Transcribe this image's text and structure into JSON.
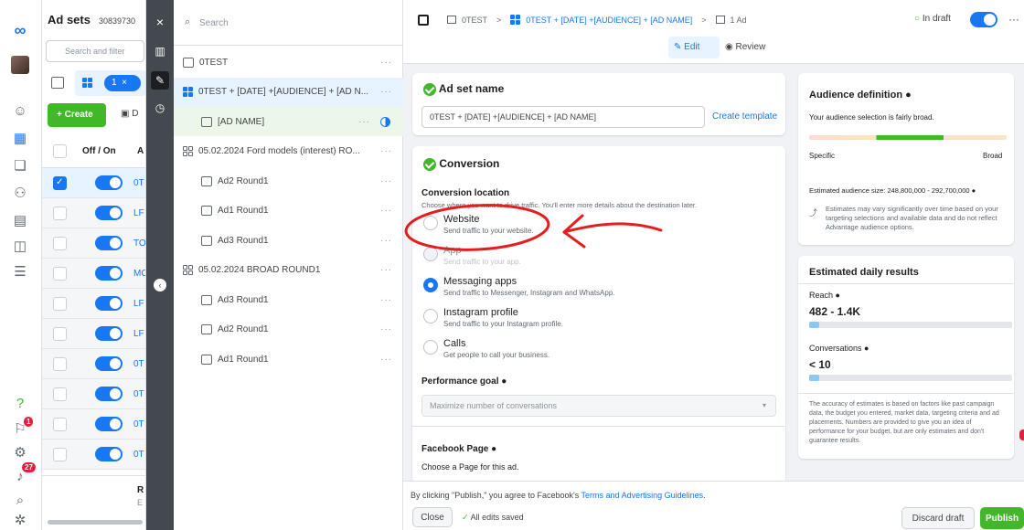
{
  "app": {
    "title": "Ad sets",
    "account_id": "30839730"
  },
  "rail": {
    "badge_notifications": "1",
    "badge_alerts": "27"
  },
  "table": {
    "search_placeholder": "Search and filter",
    "selected_count": "1",
    "create_label": "+ Create",
    "dup_label": "D",
    "col_offon": "Off / On",
    "col_name": "A",
    "rows": [
      {
        "name": "0T",
        "checked": true
      },
      {
        "name": "LF",
        "checked": false
      },
      {
        "name": "TO",
        "checked": false
      },
      {
        "name": "MC",
        "checked": false
      },
      {
        "name": "LF",
        "checked": false
      },
      {
        "name": "LF",
        "checked": false
      },
      {
        "name": "0T",
        "checked": false
      },
      {
        "name": "0T",
        "checked": false
      },
      {
        "name": "0T",
        "checked": false
      },
      {
        "name": "0T",
        "checked": false
      }
    ],
    "footer_r": "R",
    "footer_e": "E"
  },
  "tree": {
    "search_placeholder": "Search",
    "items": [
      {
        "label": "0TEST",
        "kind": "campaign",
        "indent": 0,
        "selected": false
      },
      {
        "label": "0TEST + [DATE] +[AUDIENCE] + [AD N...",
        "kind": "adset-blue",
        "indent": 0,
        "selected": true
      },
      {
        "label": "[AD NAME]",
        "kind": "ad",
        "indent": 1,
        "selected": true
      },
      {
        "label": "05.02.2024 Ford models (interest) RO...",
        "kind": "adset-gray",
        "indent": 0,
        "selected": false
      },
      {
        "label": "Ad2 Round1",
        "kind": "ad",
        "indent": 1,
        "selected": false
      },
      {
        "label": "Ad1 Round1",
        "kind": "ad",
        "indent": 1,
        "selected": false
      },
      {
        "label": "Ad3 Round1",
        "kind": "ad",
        "indent": 1,
        "selected": false
      },
      {
        "label": "05.02.2024 BROAD ROUND1",
        "kind": "adset-gray",
        "indent": 0,
        "selected": false
      },
      {
        "label": "Ad3 Round1",
        "kind": "ad",
        "indent": 1,
        "selected": false
      },
      {
        "label": "Ad2 Round1",
        "kind": "ad",
        "indent": 1,
        "selected": false
      },
      {
        "label": "Ad1 Round1",
        "kind": "ad",
        "indent": 1,
        "selected": false
      }
    ]
  },
  "breadcrumb": {
    "campaign": "0TEST",
    "adset": "0TEST + [DATE] +[AUDIENCE] + [AD NAME]",
    "ad": "1 Ad",
    "status": "In draft",
    "sep": ">"
  },
  "modes": {
    "edit": "Edit",
    "review": "Review"
  },
  "adset_name": {
    "heading": "Ad set name",
    "value": "0TEST + [DATE] +[AUDIENCE] + [AD NAME]",
    "template_link": "Create template"
  },
  "conversion": {
    "heading": "Conversion",
    "location_label": "Conversion location",
    "location_desc": "Choose where you want to drive traffic. You'll enter more details about the destination later.",
    "options": [
      {
        "title": "Website",
        "sub": "Send traffic to your website.",
        "selected": false
      },
      {
        "title": "App",
        "sub": "Send traffic to your app.",
        "selected": false
      },
      {
        "title": "Messaging apps",
        "sub": "Send traffic to Messenger, Instagram and WhatsApp.",
        "selected": true
      },
      {
        "title": "Instagram profile",
        "sub": "Send traffic to your Instagram profile.",
        "selected": false
      },
      {
        "title": "Calls",
        "sub": "Get people to call your business.",
        "selected": false
      }
    ],
    "goal_label": "Performance goal",
    "goal_value": "Maximize number of conversations",
    "page_label": "Facebook Page",
    "page_desc": "Choose a Page for this ad."
  },
  "audience": {
    "heading": "Audience definition",
    "desc": "Your audience selection is fairly broad.",
    "specific": "Specific",
    "broad": "Broad",
    "size": "Estimated audience size: 248,800,000 - 292,700,000",
    "note": "Estimates may vary significantly over time based on your targeting selections and available data and do not reflect Advantage audience options."
  },
  "daily": {
    "heading": "Estimated daily results",
    "reach_label": "Reach",
    "reach_value": "482 - 1.4K",
    "reach_fill": 0.05,
    "conv_label": "Conversations",
    "conv_value": "< 10",
    "conv_fill": 0.05,
    "note": "The accuracy of estimates is based on factors like past campaign data, the budget you entered, market data, targeting criteria and ad placements. Numbers are provided to give you an idea of performance for your budget, but are only estimates and don't guarantee results."
  },
  "footer": {
    "notice_prefix": "By clicking \"Publish,\" you agree to Facebook's ",
    "notice_link": "Terms and Advertising Guidelines",
    "notice_suffix": ".",
    "close": "Close",
    "saved": "All edits saved",
    "discard": "Discard draft",
    "publish": "Publish"
  },
  "colors": {
    "accent": "#1877f2",
    "green": "#42b72a",
    "annotation": "#e41e1e"
  }
}
